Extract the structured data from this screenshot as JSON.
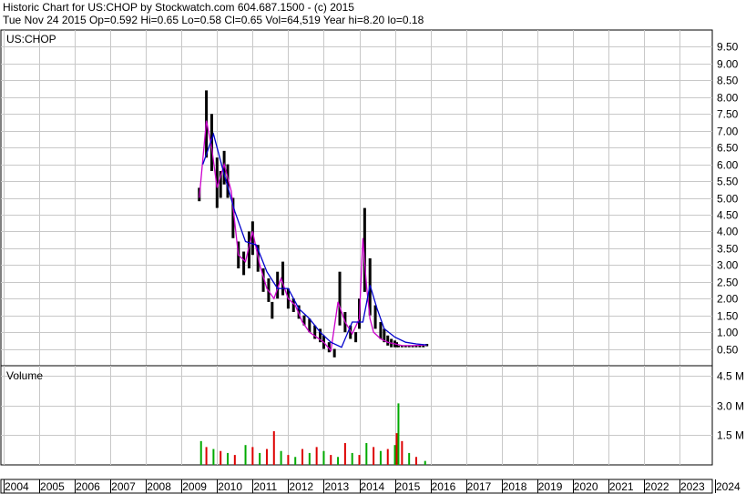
{
  "header": {
    "line1": "Historic Chart for US:CHOP by Stockwatch.com 604.687.1500 - (c) 2015",
    "line2": "Tue Nov 24 2015  Op=0.592  Hi=0.65  Lo=0.58  Cl=0.65  Vol=64,519  Year hi=8.20  lo=0.18"
  },
  "colors": {
    "grid": "#c8c8c8",
    "frame": "#000000",
    "price_up": "#000000",
    "ma_short": "#cc00cc",
    "ma_long": "#0000cc",
    "vol_up": "#00aa00",
    "vol_down": "#dd0000"
  },
  "chart_data": [
    {
      "type": "line",
      "panel": "price",
      "title": "US:CHOP",
      "ylim": [
        0,
        10
      ],
      "yticks": [
        "9.50",
        "9.00",
        "8.50",
        "8.00",
        "7.50",
        "7.00",
        "6.50",
        "6.00",
        "5.50",
        "5.00",
        "4.50",
        "4.00",
        "3.50",
        "3.00",
        "2.50",
        "2.00",
        "1.50",
        "1.00",
        "0.50"
      ],
      "ytick_values": [
        9.5,
        9,
        8.5,
        8,
        7.5,
        7,
        6.5,
        6,
        5.5,
        5,
        4.5,
        4,
        3.5,
        3,
        2.5,
        2,
        1.5,
        1,
        0.5
      ],
      "x_unit": "year",
      "xlim": [
        2004,
        2024
      ],
      "grid": true,
      "series": [
        {
          "role": "price-high-low",
          "x": [
            2009.5,
            2009.7,
            2009.85,
            2010.0,
            2010.1,
            2010.2,
            2010.3,
            2010.45,
            2010.6,
            2010.75,
            2010.9,
            2011.0,
            2011.15,
            2011.3,
            2011.45,
            2011.55,
            2011.7,
            2011.85,
            2012.0,
            2012.15,
            2012.3,
            2012.45,
            2012.6,
            2012.75,
            2012.9,
            2013.0,
            2013.15,
            2013.3,
            2013.45,
            2013.6,
            2013.75,
            2013.9,
            2014.0,
            2014.15,
            2014.3,
            2014.45,
            2014.6,
            2014.7,
            2014.8,
            2014.9,
            2015.0,
            2015.05,
            2015.1,
            2015.2,
            2015.3,
            2015.4,
            2015.5,
            2015.6,
            2015.7,
            2015.8,
            2015.9
          ],
          "high": [
            5.3,
            8.2,
            7.5,
            6.2,
            5.8,
            6.4,
            6.0,
            5.0,
            3.7,
            3.4,
            4.0,
            4.3,
            3.6,
            2.9,
            2.6,
            1.9,
            2.8,
            3.1,
            2.3,
            2.0,
            1.8,
            1.5,
            1.4,
            1.2,
            1.1,
            0.9,
            0.7,
            0.5,
            2.8,
            1.6,
            1.2,
            1.0,
            2.0,
            4.7,
            3.2,
            1.8,
            1.3,
            1.1,
            0.9,
            0.8,
            0.75,
            0.7,
            0.6,
            0.6,
            0.6,
            0.6,
            0.6,
            0.6,
            0.6,
            0.6,
            0.65
          ],
          "low": [
            4.9,
            6.2,
            5.8,
            4.7,
            5.0,
            5.4,
            5.0,
            3.8,
            2.9,
            2.7,
            2.9,
            3.3,
            2.8,
            2.2,
            1.9,
            1.4,
            2.0,
            2.1,
            1.7,
            1.6,
            1.4,
            1.2,
            1.0,
            0.8,
            0.7,
            0.5,
            0.4,
            0.25,
            1.2,
            1.0,
            0.8,
            0.7,
            1.1,
            2.2,
            1.5,
            1.1,
            0.8,
            0.7,
            0.6,
            0.55,
            0.55,
            0.55,
            0.55,
            0.55,
            0.55,
            0.55,
            0.55,
            0.55,
            0.55,
            0.55,
            0.58
          ]
        },
        {
          "role": "moving-average-short",
          "x": [
            2009.5,
            2009.7,
            2009.85,
            2010.0,
            2010.2,
            2010.4,
            2010.6,
            2010.8,
            2011.0,
            2011.2,
            2011.4,
            2011.6,
            2011.8,
            2012.0,
            2012.2,
            2012.4,
            2012.6,
            2012.8,
            2013.0,
            2013.2,
            2013.4,
            2013.6,
            2013.8,
            2014.0,
            2014.1,
            2014.2,
            2014.3,
            2014.4,
            2014.6,
            2014.8,
            2015.0,
            2015.2,
            2015.5,
            2015.9
          ],
          "values": [
            5.0,
            7.3,
            6.5,
            5.3,
            6.0,
            5.2,
            3.3,
            3.1,
            4.0,
            3.0,
            2.3,
            2.0,
            2.6,
            2.0,
            1.8,
            1.3,
            1.0,
            0.85,
            0.7,
            0.45,
            1.9,
            1.3,
            0.95,
            1.4,
            3.8,
            2.4,
            1.4,
            1.0,
            0.8,
            0.7,
            0.65,
            0.6,
            0.6,
            0.62
          ]
        },
        {
          "role": "moving-average-long",
          "x": [
            2009.6,
            2009.9,
            2010.2,
            2010.5,
            2010.8,
            2011.1,
            2011.4,
            2011.7,
            2012.0,
            2012.3,
            2012.6,
            2012.9,
            2013.2,
            2013.5,
            2013.8,
            2014.1,
            2014.3,
            2014.5,
            2014.7,
            2015.0,
            2015.3,
            2015.6,
            2015.9
          ],
          "values": [
            6.0,
            6.9,
            5.7,
            4.6,
            3.7,
            3.6,
            2.8,
            2.3,
            2.3,
            1.7,
            1.4,
            1.0,
            0.7,
            0.55,
            1.3,
            1.3,
            2.4,
            1.7,
            1.1,
            0.85,
            0.7,
            0.65,
            0.62
          ]
        }
      ]
    },
    {
      "type": "bar",
      "panel": "volume",
      "title": "Volume",
      "ylim": [
        0,
        5000000
      ],
      "yticks": [
        "4.5 M",
        "3.0 M",
        "1.5 M"
      ],
      "ytick_values": [
        4500000,
        3000000,
        1500000
      ],
      "xlim": [
        2004,
        2024
      ],
      "x": [
        2009.55,
        2009.7,
        2009.9,
        2010.1,
        2010.3,
        2010.5,
        2010.8,
        2011.0,
        2011.2,
        2011.4,
        2011.6,
        2011.8,
        2012.0,
        2012.2,
        2012.4,
        2012.6,
        2012.8,
        2013.0,
        2013.2,
        2013.4,
        2013.6,
        2013.8,
        2014.0,
        2014.2,
        2014.4,
        2014.6,
        2014.8,
        2015.0,
        2015.05,
        2015.1,
        2015.2,
        2015.4,
        2015.6,
        2015.85
      ],
      "values": [
        1200000,
        900000,
        800000,
        700000,
        600000,
        500000,
        1000000,
        900000,
        600000,
        800000,
        1700000,
        700000,
        500000,
        400000,
        800000,
        600000,
        900000,
        700000,
        500000,
        400000,
        1100000,
        600000,
        500000,
        1100000,
        900000,
        700000,
        800000,
        1000000,
        1600000,
        3100000,
        1200000,
        600000,
        400000,
        200000
      ],
      "direction": [
        "up",
        "down",
        "up",
        "down",
        "up",
        "down",
        "up",
        "down",
        "up",
        "down",
        "down",
        "up",
        "down",
        "up",
        "down",
        "up",
        "down",
        "up",
        "down",
        "up",
        "down",
        "up",
        "down",
        "up",
        "down",
        "up",
        "down",
        "up",
        "down",
        "up",
        "down",
        "up",
        "down",
        "up"
      ]
    }
  ],
  "x_axis": {
    "labels": [
      "2004",
      "2005",
      "2006",
      "2007",
      "2008",
      "2009",
      "2010",
      "2011",
      "2012",
      "2013",
      "2014",
      "2015",
      "2016",
      "2017",
      "2018",
      "2019",
      "2020",
      "2021",
      "2022",
      "2023",
      "2024"
    ],
    "values": [
      2004,
      2005,
      2006,
      2007,
      2008,
      2009,
      2010,
      2011,
      2012,
      2013,
      2014,
      2015,
      2016,
      2017,
      2018,
      2019,
      2020,
      2021,
      2022,
      2023,
      2024
    ]
  }
}
